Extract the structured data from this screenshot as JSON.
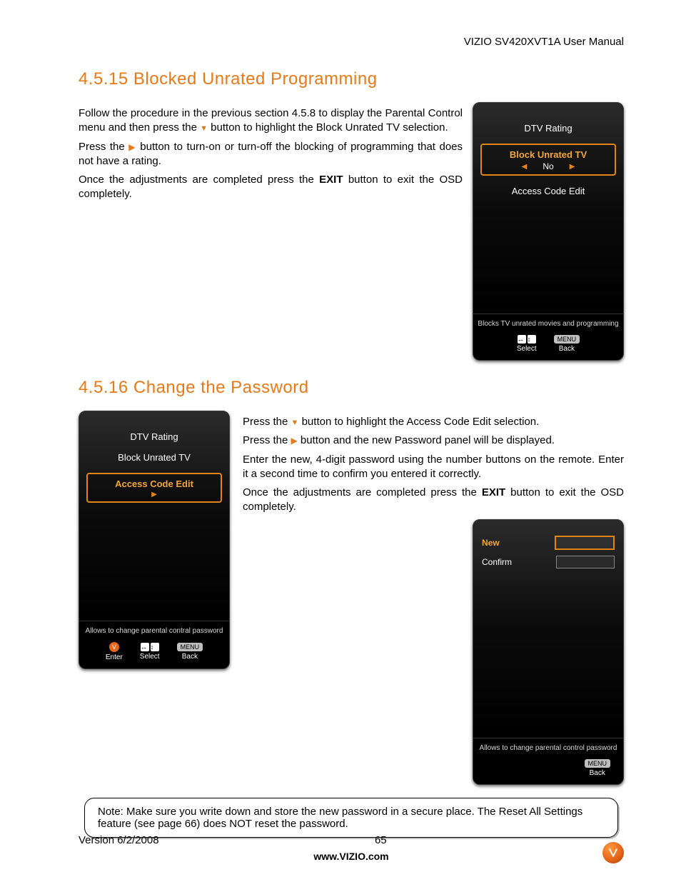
{
  "header": {
    "doc_title": "VIZIO SV420XVT1A User Manual"
  },
  "section1": {
    "number": "4.5.15",
    "title": "Blocked Unrated Programming",
    "p1a": "Follow the procedure in the previous section 4.5.8 to display the Parental Control menu and then press the ",
    "p1b": " button to highlight the Block Unrated TV selection.",
    "p2a": "Press the ",
    "p2b": " button to turn-on or turn-off the blocking of programming that does not have a rating.",
    "p3a": "Once the adjustments are completed press the ",
    "p3b": "EXIT",
    "p3c": " button to exit the OSD completely."
  },
  "osd1": {
    "items": {
      "dtv": "DTV Rating",
      "block": "Block Unrated TV",
      "value": "No",
      "ace": "Access Code Edit"
    },
    "hint": "Blocks TV unrated movies and programming",
    "nav": {
      "select": "Select",
      "back": "Back",
      "menu": "MENU"
    }
  },
  "section2": {
    "number": "4.5.16",
    "title": "Change the Password",
    "p1a": "Press the ",
    "p1b": " button to highlight the Access Code Edit selection.",
    "p2a": "Press the ",
    "p2b": " button and the new Password panel will be displayed.",
    "p3": "Enter the new, 4-digit password using the number buttons on the remote. Enter it a second time to confirm you entered it correctly.",
    "p4a": "Once the adjustments are completed press the ",
    "p4b": "EXIT",
    "p4c": " button to exit the OSD completely."
  },
  "osd2": {
    "items": {
      "dtv": "DTV Rating",
      "block": "Block Unrated TV",
      "ace": "Access Code Edit"
    },
    "hint": "Allows to change parental contral password",
    "nav": {
      "enter": "Enter",
      "select": "Select",
      "back": "Back",
      "menu": "MENU"
    }
  },
  "osd3": {
    "new_label": "New",
    "confirm_label": "Confirm",
    "hint": "Allows to change parental  control password",
    "nav": {
      "back": "Back",
      "menu": "MENU"
    }
  },
  "note": "Note: Make sure you write down and store the new password in a secure place. The Reset All Settings feature (see page 66) does NOT reset the password.",
  "footer": {
    "version": "Version 6/2/2008",
    "page": "65",
    "url": "www.VIZIO.com"
  }
}
